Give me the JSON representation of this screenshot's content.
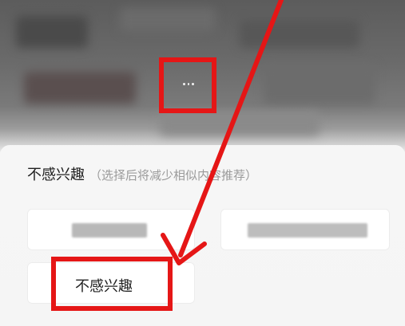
{
  "sheet": {
    "title": "不感兴趣",
    "subtitle": "（选择后将减少相似内容推荐）",
    "options": [
      {
        "label": "",
        "blurred": true
      },
      {
        "label": "",
        "blurred": true
      },
      {
        "label": "不感兴趣",
        "blurred": false
      }
    ]
  },
  "colors": {
    "highlight": "#e51616",
    "sheet_bg": "#f5f5f5",
    "option_bg": "#ffffff",
    "title_text": "#1f1f1f",
    "subtitle_text": "#9a9a9a"
  },
  "icons": {
    "more": "more-dots-icon",
    "arrow": "red-arrow-annotation"
  }
}
